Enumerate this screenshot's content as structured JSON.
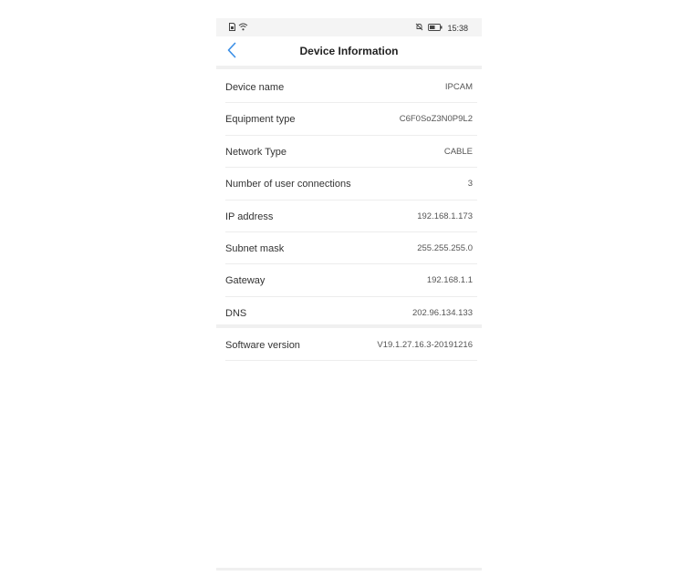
{
  "status_bar": {
    "time": "15:38",
    "battery_level": "47",
    "icons": [
      "sim-icon",
      "wifi-icon",
      "mute-icon",
      "battery-icon"
    ]
  },
  "header": {
    "title": "Device Information",
    "back_icon": "chevron-left-icon"
  },
  "device_info": [
    {
      "label": "Device name",
      "value": "IPCAM"
    },
    {
      "label": "Equipment type",
      "value": "C6F0SoZ3N0P9L2"
    },
    {
      "label": "Network Type",
      "value": "CABLE"
    },
    {
      "label": "Number of user connections",
      "value": "3"
    },
    {
      "label": "IP address",
      "value": "192.168.1.173"
    },
    {
      "label": "Subnet mask",
      "value": "255.255.255.0"
    },
    {
      "label": "Gateway",
      "value": "192.168.1.1"
    },
    {
      "label": "DNS",
      "value": "202.96.134.133"
    }
  ],
  "software": {
    "label": "Software version",
    "value": "V19.1.27.16.3-20191216"
  },
  "colors": {
    "accent": "#3a8ee6",
    "divider": "#f0f0f0"
  }
}
